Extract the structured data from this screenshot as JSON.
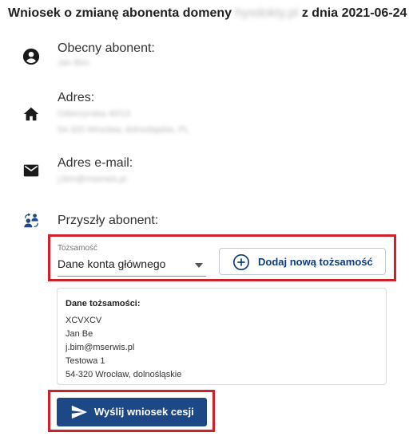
{
  "header": {
    "prefix": "Wniosek o zmianę abonenta domeny",
    "domain": "hyxdokty.pl",
    "suffix": "z dnia 2021-06-24"
  },
  "current_subscriber": {
    "label": "Obecny abonent:",
    "value": "Jan Bim"
  },
  "address": {
    "label": "Adres:",
    "line1": "Odwrzynska 40/13",
    "line2": "54-320 Wrocław, dolnośląskie, PL"
  },
  "email": {
    "label": "Adres e-mail:",
    "value": "j.bim@mserwis.pl"
  },
  "future_subscriber": {
    "label": "Przyszły abonent:",
    "identity_select": {
      "label": "Tożsamość",
      "value": "Dane konta głównego"
    },
    "add_identity_label": "Dodaj nową tożsamość"
  },
  "identity_card": {
    "title": "Dane tożsamości:",
    "lines": [
      "XCVXCV",
      "Jan Be",
      "j.bim@mserwis.pl",
      "Testowa 1",
      "54-320 Wrocław, dolnośląskie"
    ]
  },
  "send_button": {
    "label": "Wyślij wniosek cesji"
  },
  "colors": {
    "accent": "#1c4985",
    "highlight_border": "#d0212a",
    "button_text": "#0d3c7e"
  },
  "icons": [
    "account-circle-icon",
    "home-icon",
    "mail-icon",
    "transfer-users-icon",
    "plus-circle-icon",
    "send-icon"
  ]
}
